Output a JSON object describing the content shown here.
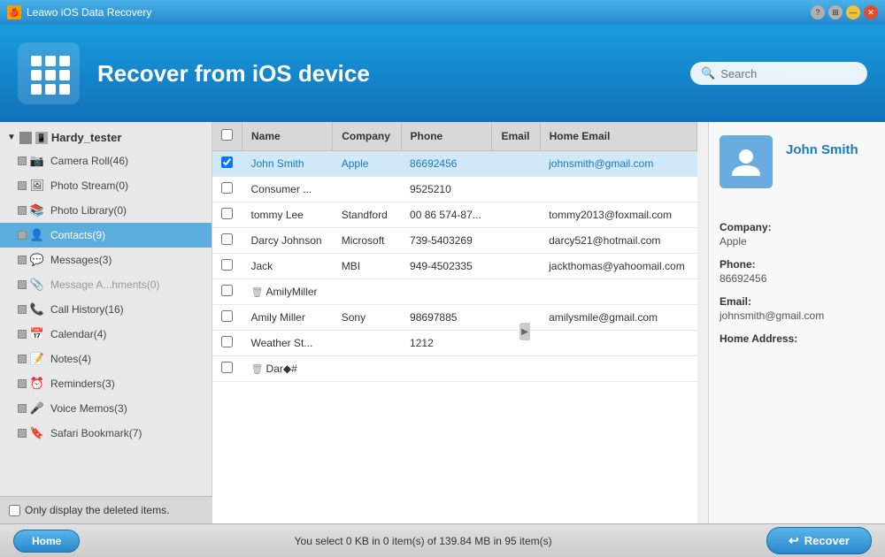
{
  "titleBar": {
    "appName": "Leawo iOS Data Recovery",
    "helpLabel": "?",
    "minLabel": "—",
    "closeLabel": "✕"
  },
  "header": {
    "title": "Recover from iOS device",
    "search": {
      "placeholder": "Search"
    }
  },
  "sidebar": {
    "deviceName": "Hardy_tester",
    "items": [
      {
        "id": "camera-roll",
        "label": "Camera Roll(46)",
        "icon": "📷",
        "active": false,
        "disabled": false
      },
      {
        "id": "photo-stream",
        "label": "Photo Stream(0)",
        "icon": "🖼",
        "active": false,
        "disabled": false
      },
      {
        "id": "photo-library",
        "label": "Photo Library(0)",
        "icon": "📚",
        "active": false,
        "disabled": false
      },
      {
        "id": "contacts",
        "label": "Contacts(9)",
        "icon": "👤",
        "active": true,
        "disabled": false
      },
      {
        "id": "messages",
        "label": "Messages(3)",
        "icon": "💬",
        "active": false,
        "disabled": false
      },
      {
        "id": "message-attachments",
        "label": "Message A...hments(0)",
        "icon": "📎",
        "active": false,
        "disabled": true
      },
      {
        "id": "call-history",
        "label": "Call History(16)",
        "icon": "📞",
        "active": false,
        "disabled": false
      },
      {
        "id": "calendar",
        "label": "Calendar(4)",
        "icon": "📅",
        "active": false,
        "disabled": false
      },
      {
        "id": "notes",
        "label": "Notes(4)",
        "icon": "📝",
        "active": false,
        "disabled": false
      },
      {
        "id": "reminders",
        "label": "Reminders(3)",
        "icon": "⏰",
        "active": false,
        "disabled": false
      },
      {
        "id": "voice-memos",
        "label": "Voice Memos(3)",
        "icon": "🎤",
        "active": false,
        "disabled": false
      },
      {
        "id": "safari-bookmark",
        "label": "Safari Bookmark(7)",
        "icon": "🔖",
        "active": false,
        "disabled": false
      }
    ],
    "showDeletedLabel": "Only display the deleted items."
  },
  "table": {
    "columns": [
      "Name",
      "Company",
      "Phone",
      "Email",
      "Home Email"
    ],
    "rows": [
      {
        "id": 1,
        "checked": true,
        "deleted": false,
        "name": "John Smith",
        "company": "Apple",
        "phone": "86692456",
        "email": "",
        "homeEmail": "johnsmith@gmail.com",
        "selected": true
      },
      {
        "id": 2,
        "checked": false,
        "deleted": false,
        "name": "Consumer ...",
        "company": "",
        "phone": "9525210",
        "email": "",
        "homeEmail": "",
        "selected": false
      },
      {
        "id": 3,
        "checked": false,
        "deleted": false,
        "name": "tommy Lee",
        "company": "Standford",
        "phone": "00 86 574-87...",
        "email": "",
        "homeEmail": "tommy2013@foxmail.com",
        "selected": false
      },
      {
        "id": 4,
        "checked": false,
        "deleted": false,
        "name": "Darcy Johnson",
        "company": "Microsoft",
        "phone": "739-5403269",
        "email": "",
        "homeEmail": "darcy521@hotmail.com",
        "selected": false
      },
      {
        "id": 5,
        "checked": false,
        "deleted": false,
        "name": "Jack",
        "company": "MBI",
        "phone": "949-4502335",
        "email": "",
        "homeEmail": "jackthomas@yahoomail.com",
        "selected": false
      },
      {
        "id": 6,
        "checked": false,
        "deleted": true,
        "name": "AmilyMiller",
        "company": "",
        "phone": "",
        "email": "",
        "homeEmail": "",
        "selected": false
      },
      {
        "id": 7,
        "checked": false,
        "deleted": false,
        "name": "Amily Miller",
        "company": "Sony",
        "phone": "98697885",
        "email": "",
        "homeEmail": "amilysmile@gmail.com",
        "selected": false
      },
      {
        "id": 8,
        "checked": false,
        "deleted": false,
        "name": "Weather St...",
        "company": "",
        "phone": "1212",
        "email": "",
        "homeEmail": "",
        "selected": false
      },
      {
        "id": 9,
        "checked": false,
        "deleted": true,
        "name": "Dar◆#",
        "company": "",
        "phone": "",
        "email": "",
        "homeEmail": "",
        "selected": false
      }
    ]
  },
  "detail": {
    "name": "John Smith",
    "companyLabel": "Company:",
    "companyValue": "Apple",
    "phoneLabel": "Phone:",
    "phoneValue": "86692456",
    "emailLabel": "Email:",
    "emailValue": "johnsmith@gmail.com",
    "homeAddressLabel": "Home Address:",
    "homeAddressValue": ""
  },
  "footer": {
    "homeLabel": "Home",
    "statusText": "You select 0 KB in 0 item(s) of 139.84 MB in 95 item(s)",
    "recoverLabel": "Recover"
  }
}
